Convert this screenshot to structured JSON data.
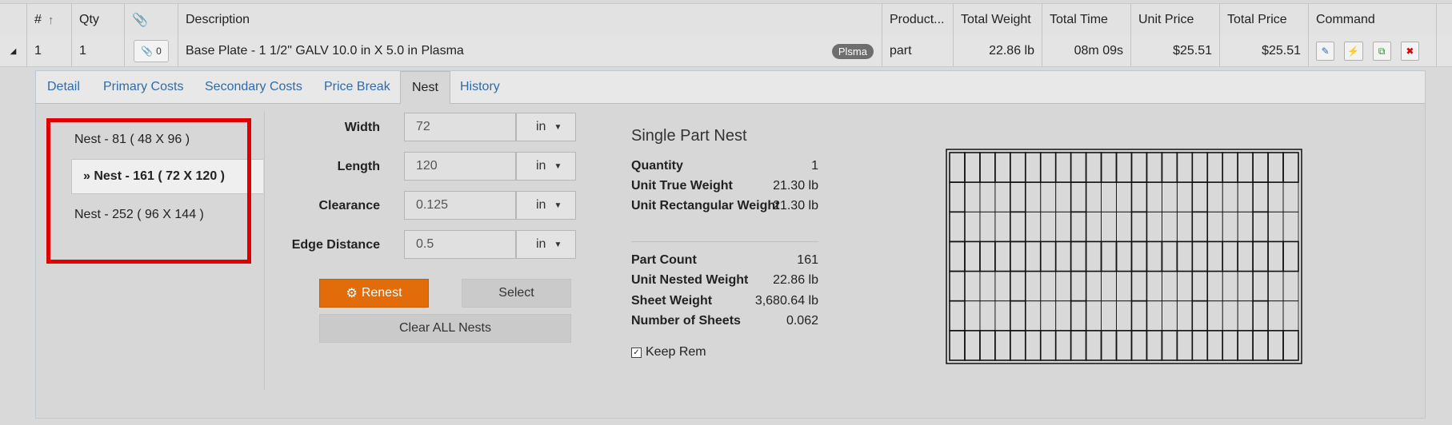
{
  "header": {
    "num": "#",
    "qty": "Qty",
    "description": "Description",
    "product": "Product...",
    "total_weight": "Total Weight",
    "total_time": "Total Time",
    "unit_price": "Unit Price",
    "total_price": "Total Price",
    "command": "Command"
  },
  "row": {
    "num": "1",
    "qty": "1",
    "attachments": "0",
    "description": "Base Plate - 1 1/2\" GALV 10.0 in X 5.0 in Plasma",
    "badge": "Plsma",
    "product": "part",
    "total_weight": "22.86 lb",
    "total_time": "08m 09s",
    "unit_price": "$25.51",
    "total_price": "$25.51"
  },
  "tabs": [
    "Detail",
    "Primary Costs",
    "Secondary Costs",
    "Price Break",
    "Nest",
    "History"
  ],
  "active_tab": "Nest",
  "nests": [
    {
      "label": "Nest - 81 ( 48 X 96 )"
    },
    {
      "label": "» Nest - 161 ( 72 X 120 )"
    },
    {
      "label": "Nest - 252 ( 96 X 144 )"
    }
  ],
  "selected_nest": 1,
  "form": {
    "width": {
      "label": "Width",
      "value": "72",
      "unit": "in"
    },
    "length": {
      "label": "Length",
      "value": "120",
      "unit": "in"
    },
    "clearance": {
      "label": "Clearance",
      "value": "0.125",
      "unit": "in"
    },
    "edge_distance": {
      "label": "Edge Distance",
      "value": "0.5",
      "unit": "in"
    }
  },
  "buttons": {
    "renest": "Renest",
    "select": "Select",
    "clear_all": "Clear ALL Nests"
  },
  "summary": {
    "title": "Single Part Nest",
    "quantity": {
      "label": "Quantity",
      "value": "1"
    },
    "unit_true_weight": {
      "label": "Unit True Weight",
      "value": "21.30 lb"
    },
    "unit_rect_weight": {
      "label": "Unit Rectangular Weight",
      "value": "21.30 lb"
    },
    "part_count": {
      "label": "Part Count",
      "value": "161"
    },
    "unit_nested_weight": {
      "label": "Unit Nested Weight",
      "value": "22.86 lb"
    },
    "sheet_weight": {
      "label": "Sheet Weight",
      "value": "3,680.64 lb"
    },
    "number_of_sheets": {
      "label": "Number of Sheets",
      "value": "0.062"
    },
    "keep_rem": {
      "label": "Keep Rem",
      "checked": true
    }
  },
  "nest_preview": {
    "columns": 23,
    "rows": 7
  },
  "colors": {
    "accent_orange": "#e26b0a",
    "link_blue": "#2e6ba8",
    "highlight_red": "#e00000"
  }
}
